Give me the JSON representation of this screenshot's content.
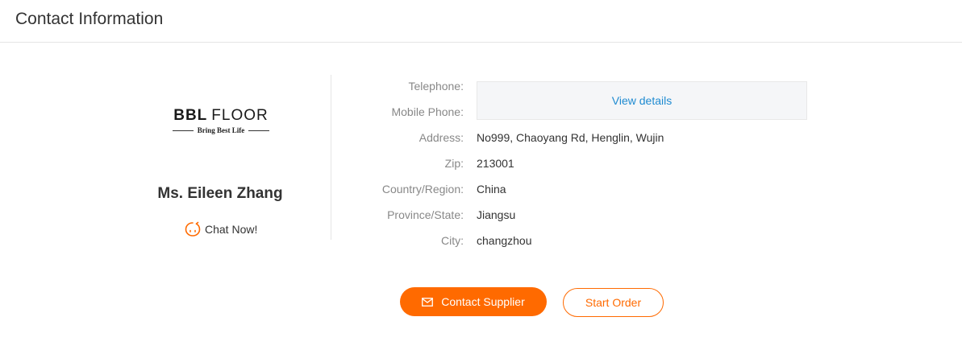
{
  "header": {
    "title": "Contact Information"
  },
  "supplier": {
    "logo_brand": "BBL",
    "logo_word": "FLOOR",
    "logo_tagline": "Bring  Best  Life",
    "contact_name": "Ms. Eileen Zhang",
    "chat_label": "Chat Now!",
    "chat_icon": "chat-face-icon"
  },
  "details": {
    "telephone_label": "Telephone:",
    "mobile_label": "Mobile Phone:",
    "view_details": "View details",
    "rows": [
      {
        "label": "Address:",
        "value": "No999, Chaoyang Rd, Henglin, Wujin"
      },
      {
        "label": "Zip:",
        "value": "213001"
      },
      {
        "label": "Country/Region:",
        "value": "China"
      },
      {
        "label": "Province/State:",
        "value": "Jiangsu"
      },
      {
        "label": "City:",
        "value": "changzhou"
      }
    ]
  },
  "actions": {
    "contact_supplier": "Contact Supplier",
    "contact_icon": "mail-icon",
    "start_order": "Start Order"
  },
  "colors": {
    "accent": "#ff6a00",
    "link": "#1f8bd1",
    "label": "#888888",
    "text": "#333333"
  }
}
